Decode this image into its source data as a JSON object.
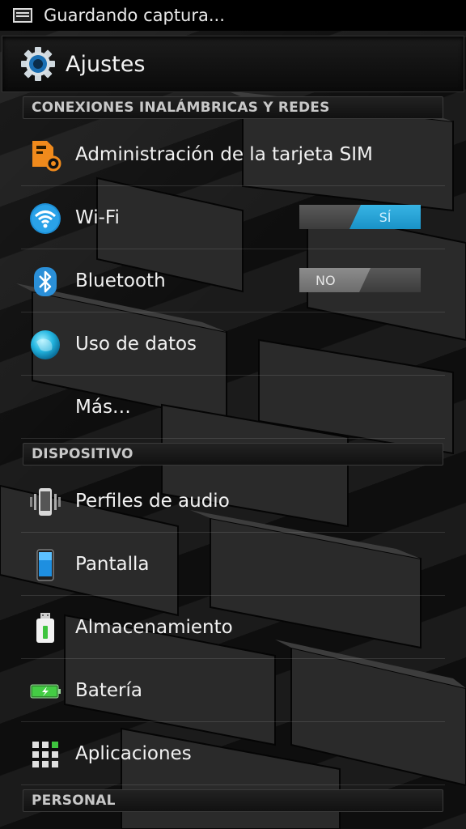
{
  "status_bar": {
    "text": "Guardando captura..."
  },
  "action_bar": {
    "title": "Ajustes"
  },
  "sections": {
    "wireless": "CONEXIONES INALÁMBRICAS Y REDES",
    "device": "DISPOSITIVO",
    "personal": "PERSONAL"
  },
  "items": {
    "sim": "Administración de la tarjeta SIM",
    "wifi": "Wi-Fi",
    "bluetooth": "Bluetooth",
    "data_usage": "Uso de datos",
    "more": "Más…",
    "audio_profiles": "Perfiles de audio",
    "display": "Pantalla",
    "storage": "Almacenamiento",
    "battery": "Batería",
    "apps": "Aplicaciones"
  },
  "toggles": {
    "wifi": {
      "state": "SÍ",
      "on": true
    },
    "bluetooth": {
      "state": "NO",
      "on": false
    }
  },
  "colors": {
    "accent": "#33b5e5",
    "sim_orange": "#f08a1c",
    "battery_green": "#3ec43e"
  }
}
